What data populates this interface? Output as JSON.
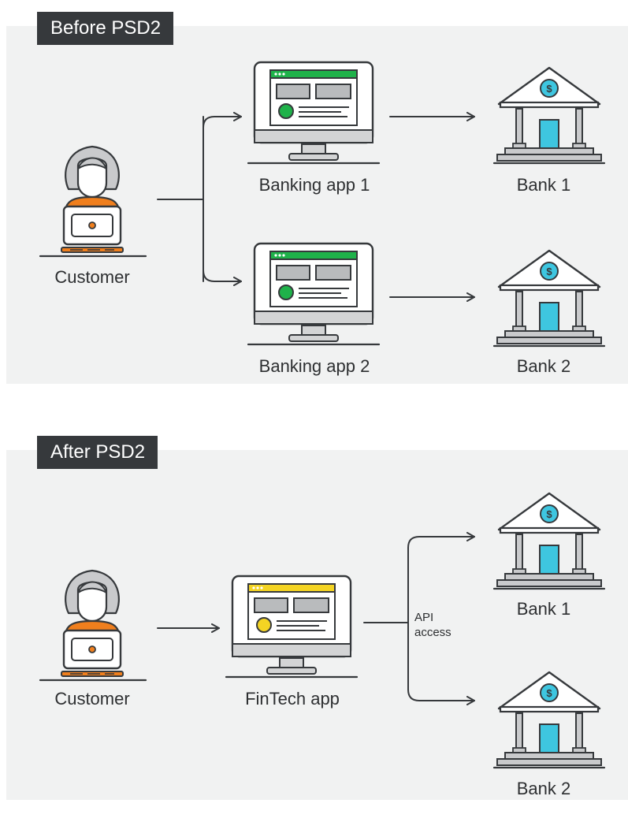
{
  "colors": {
    "panel_bg": "#f1f2f2",
    "tag_bg": "#36393c",
    "outline": "#36393c",
    "customer_accent": "#f07f1d",
    "banking_app_accent": "#1fb24a",
    "fintech_app_accent": "#f4d423",
    "bank_door": "#3ec6e0",
    "bank_coin": "#3ec6e0"
  },
  "before": {
    "title": "Before PSD2",
    "customer": {
      "label": "Customer",
      "icon": "customer-with-laptop-icon"
    },
    "apps": [
      {
        "label": "Banking app 1",
        "icon": "banking-app-monitor-icon"
      },
      {
        "label": "Banking app 2",
        "icon": "banking-app-monitor-icon"
      }
    ],
    "banks": [
      {
        "label": "Bank 1",
        "icon": "bank-building-icon"
      },
      {
        "label": "Bank 2",
        "icon": "bank-building-icon"
      }
    ]
  },
  "after": {
    "title": "After PSD2",
    "customer": {
      "label": "Customer",
      "icon": "customer-with-laptop-icon"
    },
    "app": {
      "label": "FinTech app",
      "icon": "fintech-app-monitor-icon"
    },
    "connection_label_line1": "API",
    "connection_label_line2": "access",
    "banks": [
      {
        "label": "Bank 1",
        "icon": "bank-building-icon"
      },
      {
        "label": "Bank 2",
        "icon": "bank-building-icon"
      }
    ]
  }
}
